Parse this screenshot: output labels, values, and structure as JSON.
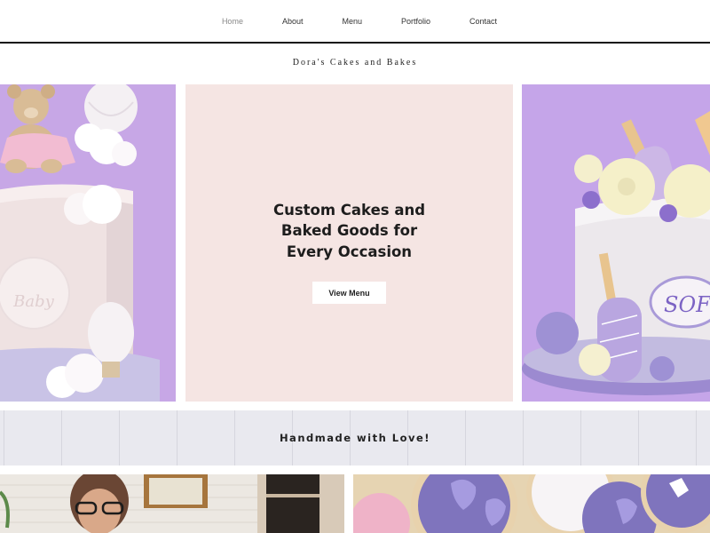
{
  "nav": {
    "items": [
      {
        "label": "Home",
        "active": true
      },
      {
        "label": "About",
        "active": false
      },
      {
        "label": "Menu",
        "active": false
      },
      {
        "label": "Portfolio",
        "active": false
      },
      {
        "label": "Contact",
        "active": false
      }
    ]
  },
  "brand": {
    "title": "Dora's Cakes and Bakes"
  },
  "hero": {
    "line1": "Custom Cakes and",
    "line2": "Baked Goods for",
    "line3": "Every Occasion",
    "button_label": "View Menu"
  },
  "band": {
    "text": "Handmade with Love!"
  },
  "images": {
    "left_cake_plaque": "Baby",
    "right_cake_plaque": "SOF"
  },
  "colors": {
    "hero_bg": "#f5e5e3",
    "lilac": "#c6a6e8",
    "band_bg": "#e9e9ef",
    "cookie_purple": "#7d74b9"
  }
}
